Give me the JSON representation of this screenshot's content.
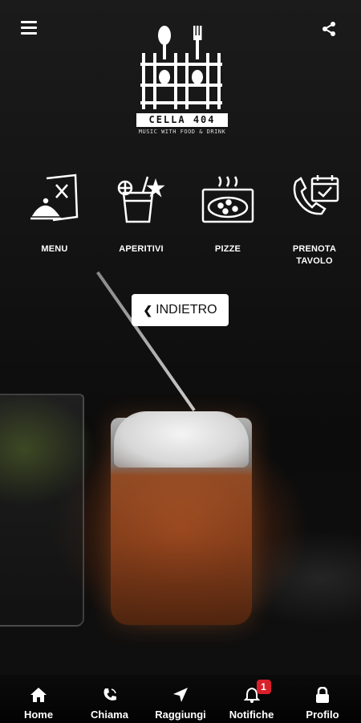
{
  "brand": {
    "name": "CELLA 404",
    "tagline": "MUSIC WITH FOOD & DRINK"
  },
  "header": {
    "menu_icon": "hamburger-icon",
    "share_icon": "share-icon"
  },
  "tiles": [
    {
      "label": "MENU",
      "icon": "menu-book-icon"
    },
    {
      "label": "APERITIVI",
      "icon": "cocktail-icon"
    },
    {
      "label": "PIZZE",
      "icon": "pizza-box-icon"
    },
    {
      "label": "PRENOTA TAVOLO",
      "icon": "phone-calendar-icon"
    }
  ],
  "back_button": {
    "label": "INDIETRO"
  },
  "bottom_nav": [
    {
      "label": "Home",
      "icon": "home-icon"
    },
    {
      "label": "Chiama",
      "icon": "phone-icon"
    },
    {
      "label": "Raggiungi",
      "icon": "location-arrow-icon"
    },
    {
      "label": "Notifiche",
      "icon": "bell-icon",
      "badge": "1"
    },
    {
      "label": "Profilo",
      "icon": "lock-icon"
    }
  ],
  "colors": {
    "badge": "#d9202a",
    "button_bg": "#ffffff"
  }
}
